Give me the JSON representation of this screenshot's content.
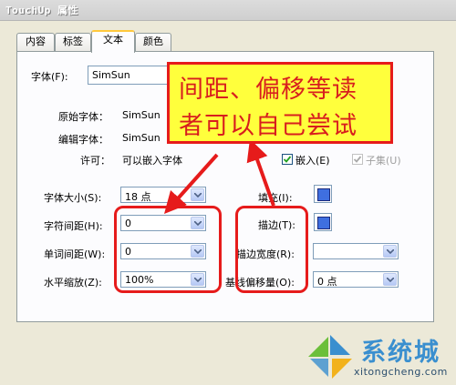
{
  "window": {
    "title": "TouchUp 属性"
  },
  "tabs": [
    {
      "label": "内容"
    },
    {
      "label": "标签"
    },
    {
      "label": "文本",
      "active": true
    },
    {
      "label": "颜色"
    }
  ],
  "font": {
    "label": "字体(F):",
    "value": "SimSun",
    "original_label": "原始字体：",
    "original_value": "SimSun",
    "edit_label": "编辑字体：",
    "edit_value": "SimSun",
    "permission_label": "许可：",
    "permission_value": "可以嵌入字体",
    "embed_label": "嵌入(E)",
    "embed_checked": true,
    "subset_label": "子集(U)",
    "subset_checked": true
  },
  "fields": {
    "font_size_label": "字体大小(S):",
    "font_size_value": "18 点",
    "char_spacing_label": "字符间距(H):",
    "char_spacing_value": "0",
    "word_spacing_label": "单词间距(W):",
    "word_spacing_value": "0",
    "h_scale_label": "水平缩放(Z):",
    "h_scale_value": "100%",
    "fill_label": "填充(I):",
    "stroke_label": "描边(T):",
    "stroke_width_label": "描边宽度(R):",
    "stroke_width_value": "",
    "baseline_label": "基线偏移量(O):",
    "baseline_value": "0 点"
  },
  "colors": {
    "fill": "#3f6fe0",
    "stroke": "#3f6fe0",
    "accent": "#ffc83c",
    "annotation": "#e61b1b",
    "callout_bg": "#ffff3c"
  },
  "annotation": {
    "line1": "间距、偏移等读",
    "line2": "者可以自己尝试"
  },
  "watermark": {
    "brand": "系统城",
    "url": "xitongcheng.com"
  },
  "icons": {
    "dropdown": "chevron-down-icon",
    "check": "check-icon",
    "logo": "windows-logo-icon"
  }
}
